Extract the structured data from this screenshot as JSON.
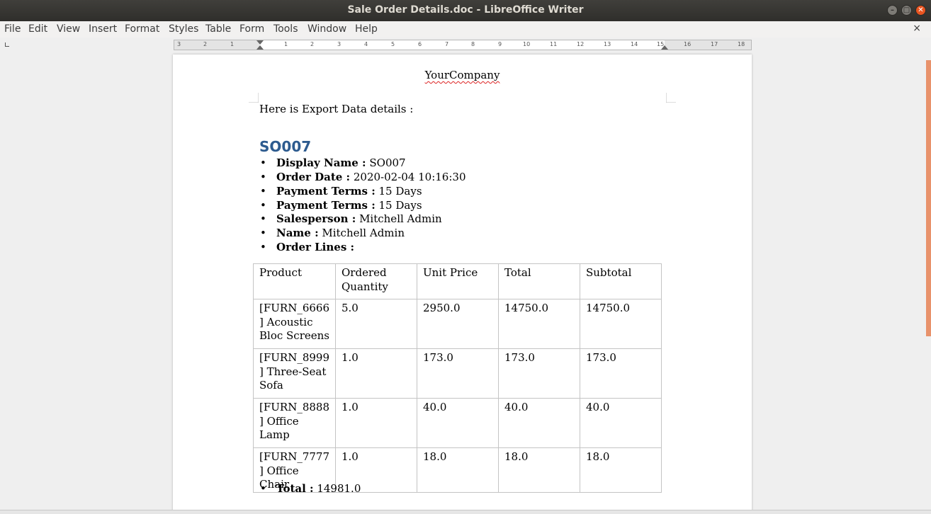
{
  "window": {
    "title": "Sale Order Details.doc - LibreOffice Writer"
  },
  "menu": [
    "File",
    "Edit",
    "View",
    "Insert",
    "Format",
    "Styles",
    "Table",
    "Form",
    "Tools",
    "Window",
    "Help"
  ],
  "close_doc_label": "×",
  "ruler": {
    "labels": [
      "3",
      "2",
      "1",
      "1",
      "2",
      "3",
      "4",
      "5",
      "6",
      "7",
      "8",
      "9",
      "10",
      "11",
      "12",
      "13",
      "14",
      "15",
      "16",
      "17",
      "18"
    ]
  },
  "document": {
    "company": "YourCompany",
    "intro": "Here is Export Data details :",
    "heading": "SO007",
    "details": [
      {
        "label": "Display Name :",
        "value": " SO007"
      },
      {
        "label": "Order Date :",
        "value": " 2020-02-04 10:16:30"
      },
      {
        "label": "Payment Terms :",
        "value": " 15 Days"
      },
      {
        "label": "Payment Terms :",
        "value": " 15 Days"
      },
      {
        "label": "Salesperson :",
        "value": " Mitchell Admin"
      },
      {
        "label": "Name :",
        "value": " Mitchell Admin"
      },
      {
        "label": "Order Lines :",
        "value": ""
      }
    ],
    "table": {
      "headers": [
        "Product",
        "Ordered Quantity",
        "Unit Price",
        "Total",
        "Subtotal"
      ],
      "rows": [
        [
          "[FURN_6666 ] Acoustic Bloc Screens",
          "5.0",
          "2950.0",
          "14750.0",
          "14750.0"
        ],
        [
          "[FURN_8999 ] Three-Seat Sofa",
          "1.0",
          "173.0",
          "173.0",
          "173.0"
        ],
        [
          "[FURN_8888 ] Office Lamp",
          "1.0",
          "40.0",
          "40.0",
          "40.0"
        ],
        [
          "[FURN_7777 ] Office Chair",
          "1.0",
          "18.0",
          "18.0",
          "18.0"
        ]
      ]
    },
    "total": {
      "label": "Total :",
      "value": " 14981.0"
    }
  }
}
